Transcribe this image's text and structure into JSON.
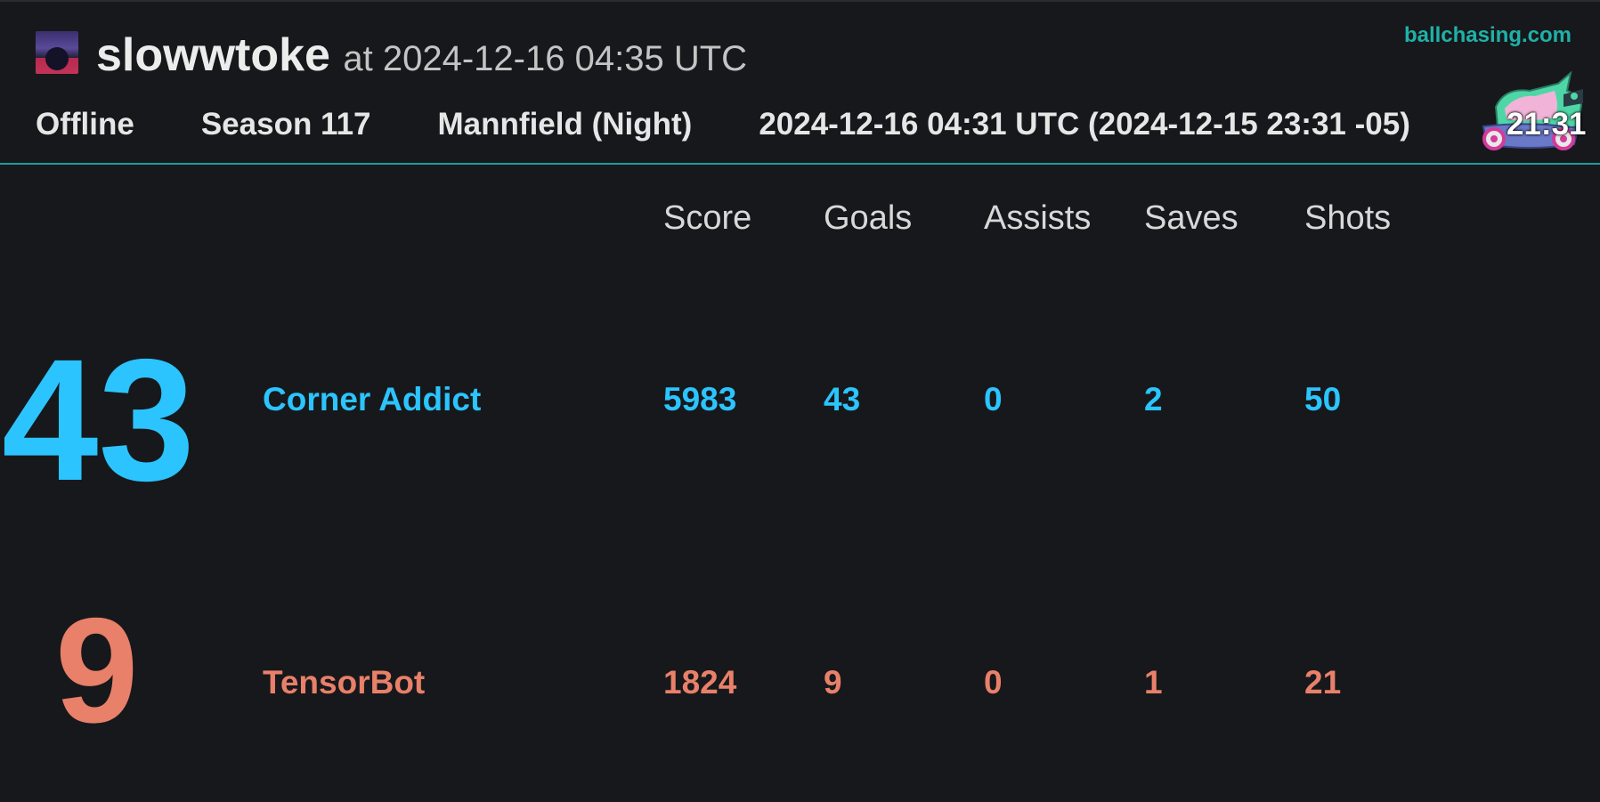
{
  "header": {
    "player_name": "slowwtoke",
    "title_at": "at 2024-12-16 04:35 UTC",
    "site_link": "ballchasing.com",
    "meta": {
      "playlist": "Offline",
      "season": "Season 117",
      "map": "Mannfield (Night)",
      "date": "2024-12-16 04:31 UTC (2024-12-15 23:31 -05)",
      "duration": "21:31"
    }
  },
  "columns": [
    "Score",
    "Goals",
    "Assists",
    "Saves",
    "Shots"
  ],
  "teams": [
    {
      "color": "#2bc4ff",
      "goals_big": "43",
      "player": "Corner Addict",
      "score": "5983",
      "goals": "43",
      "assists": "0",
      "saves": "2",
      "shots": "50"
    },
    {
      "color": "#e8806a",
      "goals_big": "9",
      "player": "TensorBot",
      "score": "1824",
      "goals": "9",
      "assists": "0",
      "saves": "1",
      "shots": "21"
    }
  ],
  "icons": {
    "avatar": "avatar-image",
    "mascot": "car-mascot-icon"
  }
}
